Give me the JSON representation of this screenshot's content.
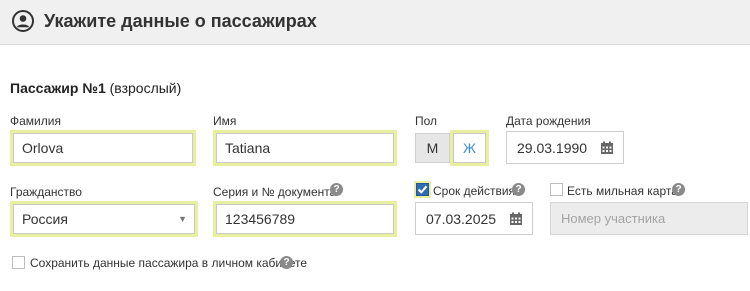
{
  "header": {
    "title": "Укажите данные о пассажирах",
    "icon": "user-circle-icon"
  },
  "passenger": {
    "title_bold": "Пассажир №1",
    "title_note": "(взрослый)"
  },
  "fields": {
    "surname": {
      "label": "Фамилия",
      "value": "Orlova"
    },
    "name": {
      "label": "Имя",
      "value": "Tatiana"
    },
    "gender": {
      "label": "Пол",
      "male": "М",
      "female": "Ж",
      "selected": "Ж"
    },
    "birthdate": {
      "label": "Дата рождения",
      "value": "29.03.1990"
    },
    "citizenship": {
      "label": "Гражданство",
      "value": "Россия"
    },
    "document": {
      "label": "Серия и № документа",
      "value": "123456789"
    },
    "validity": {
      "label": "Срок действия",
      "value": "07.03.2025",
      "checked": true
    },
    "mileage": {
      "label": "Есть мильная карта",
      "placeholder": "Номер участника",
      "checked": false
    }
  },
  "save_profile": {
    "label": "Сохранить данные пассажира в личном кабинете",
    "checked": false
  },
  "colors": {
    "highlight": "#e8ef9e",
    "accent": "#3a8fd4",
    "checkbox": "#2f6db0"
  }
}
